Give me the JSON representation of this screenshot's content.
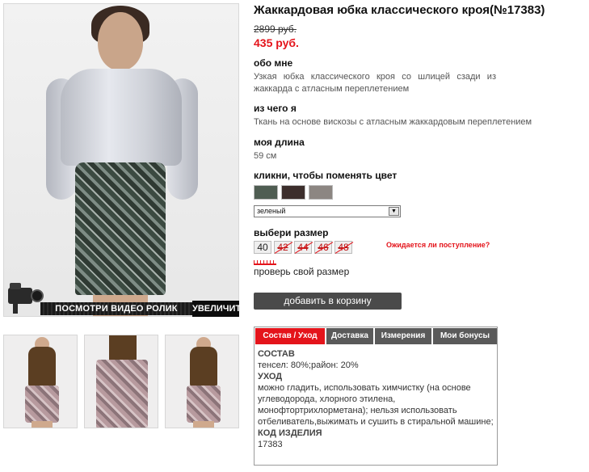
{
  "product": {
    "title": "Жаккардовая юбка классического кроя(№17383)",
    "old_price": "2899 руб.",
    "new_price": "435 руб."
  },
  "media": {
    "video_label": "ПОСМОТРИ ВИДЕО РОЛИК",
    "zoom_label": "УВЕЛИЧИТЬ"
  },
  "about": {
    "heading": "обо мне",
    "text": "Узкая юбка классического кроя со шлицей сзади из жаккарда с атласным переплетением"
  },
  "material": {
    "heading": "из чего я",
    "text": "Ткань на основе вискозы с атласным жаккардовым переплетением"
  },
  "length": {
    "heading": "моя длина",
    "text": "59 см"
  },
  "color": {
    "heading": "кликни, чтобы поменять цвет",
    "selected": "зеленый",
    "swatch_colors": [
      "#4f5d52",
      "#3c2e2c",
      "#8c8682"
    ]
  },
  "size": {
    "heading": "выбери размер",
    "options": [
      {
        "label": "40",
        "available": true
      },
      {
        "label": "42",
        "available": false
      },
      {
        "label": "44",
        "available": false
      },
      {
        "label": "46",
        "available": false
      },
      {
        "label": "48",
        "available": false
      }
    ],
    "expect_link": "Ожидается ли поступление?",
    "check_size": "проверь свой размер"
  },
  "cart": {
    "label": "добавить в корзину"
  },
  "tabs": {
    "items": [
      "Состав / Уход",
      "Доставка",
      "Измерения",
      "Мои бонусы"
    ],
    "active": 0,
    "content": {
      "composition_heading": "СОСТАВ",
      "composition_text": "тенсел: 80%;район: 20%",
      "care_heading": "УХОД",
      "care_text": "можно гладить, использовать химчистку (на основе углеводорода, хлорного этилена, монофтортрихлорметана); нельзя использовать отбеливатель,выжимать и сушить в стиральной машине;",
      "code_heading": "КОД ИЗДЕЛИЯ",
      "code_text": "17383"
    }
  },
  "colors": {
    "accent": "#e4141b",
    "button": "#4a4a4a",
    "tab": "#5a5a5a"
  }
}
